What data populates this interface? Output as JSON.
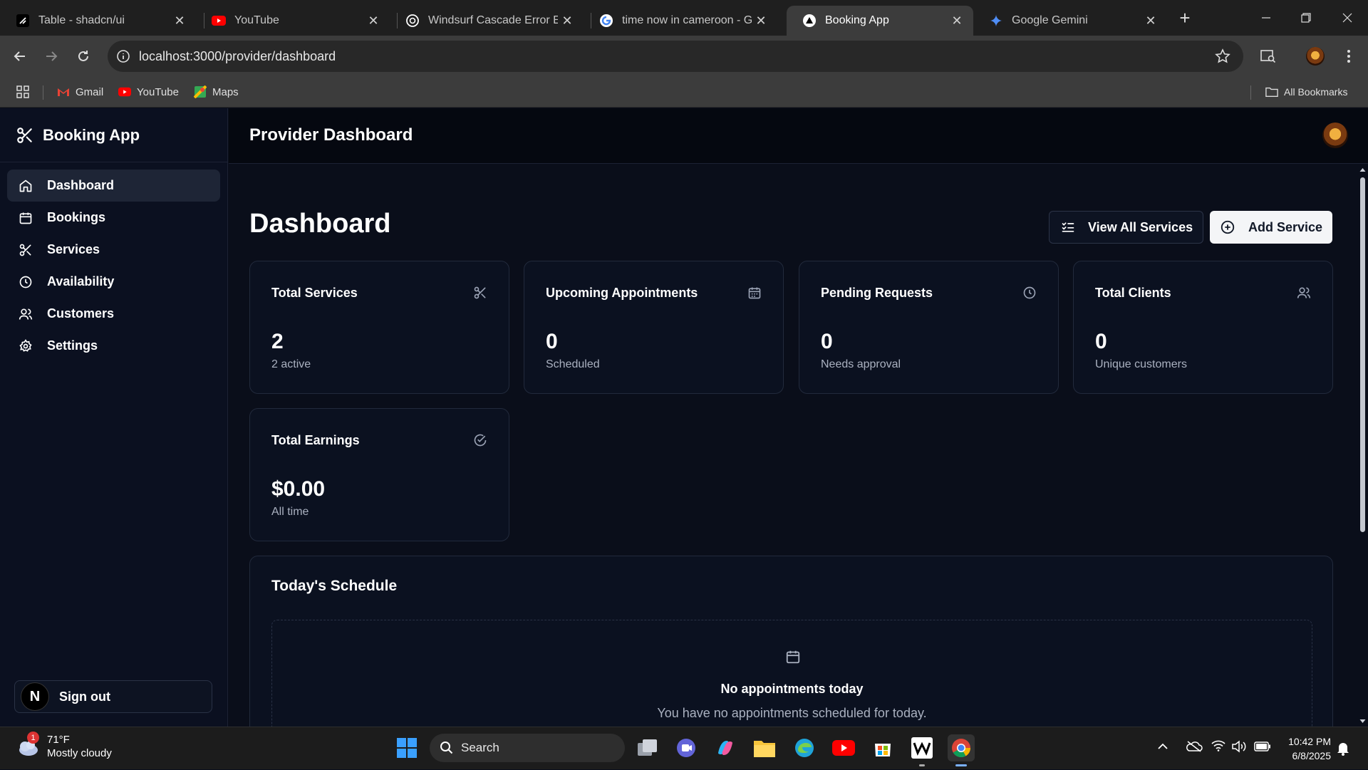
{
  "browser": {
    "tabs": [
      {
        "title": "Table - shadcn/ui",
        "icon": "shadcn-icon",
        "active": false
      },
      {
        "title": "YouTube",
        "icon": "youtube-icon",
        "active": false
      },
      {
        "title": "Windsurf Cascade Error Exp",
        "icon": "openai-icon",
        "active": false
      },
      {
        "title": "time now in cameroon - Go",
        "icon": "google-icon",
        "active": false
      },
      {
        "title": "Booking App",
        "icon": "vercel-icon",
        "active": true
      },
      {
        "title": "Google Gemini",
        "icon": "gemini-icon",
        "active": false
      }
    ],
    "url": "localhost:3000/provider/dashboard",
    "bookmarks": [
      {
        "label": "Gmail",
        "icon": "gmail-icon"
      },
      {
        "label": "YouTube",
        "icon": "youtube-icon"
      },
      {
        "label": "Maps",
        "icon": "maps-icon"
      }
    ],
    "all_bookmarks": "All Bookmarks"
  },
  "app": {
    "brand": "Booking App",
    "header_title": "Provider Dashboard",
    "nav": [
      {
        "label": "Dashboard",
        "icon": "home-icon",
        "active": true
      },
      {
        "label": "Bookings",
        "icon": "calendar-icon",
        "active": false
      },
      {
        "label": "Services",
        "icon": "scissors-icon",
        "active": false
      },
      {
        "label": "Availability",
        "icon": "clock-icon",
        "active": false
      },
      {
        "label": "Customers",
        "icon": "users-icon",
        "active": false
      },
      {
        "label": "Settings",
        "icon": "gear-icon",
        "active": false
      }
    ],
    "sign_out": "Sign out",
    "sign_out_badge": "N"
  },
  "dashboard": {
    "title": "Dashboard",
    "view_all_services": "View All Services",
    "add_service": "Add Service",
    "cards": [
      {
        "title": "Total Services",
        "value": "2",
        "sub": "2 active",
        "icon": "scissors-icon"
      },
      {
        "title": "Upcoming Appointments",
        "value": "0",
        "sub": "Scheduled",
        "icon": "calendar-icon"
      },
      {
        "title": "Pending Requests",
        "value": "0",
        "sub": "Needs approval",
        "icon": "clock-icon"
      },
      {
        "title": "Total Clients",
        "value": "0",
        "sub": "Unique customers",
        "icon": "users-icon"
      },
      {
        "title": "Total Earnings",
        "value": "$0.00",
        "sub": "All time",
        "icon": "check-circle-icon"
      }
    ],
    "schedule": {
      "title": "Today's Schedule",
      "empty_title": "No appointments today",
      "empty_text": "You have no appointments scheduled for today."
    }
  },
  "taskbar": {
    "weather_badge": "1",
    "temperature": "71°F",
    "condition": "Mostly cloudy",
    "search_placeholder": "Search",
    "time": "10:42 PM",
    "date": "6/8/2025"
  },
  "colors": {
    "accent_youtube": "#ff0000",
    "sidebar_active": "#1e2536",
    "page_bg": "#0a0e1a"
  }
}
